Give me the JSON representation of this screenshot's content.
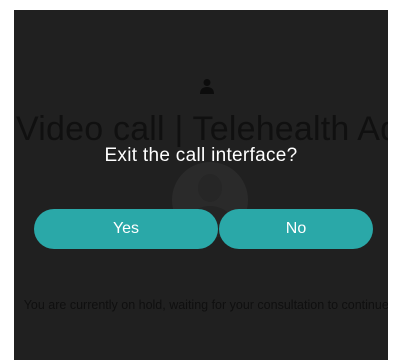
{
  "page": {
    "title": "Video call | Telehealth Admin",
    "status_text": "You are currently on hold, waiting for your consultation to continue."
  },
  "dialog": {
    "title": "Exit the call interface?",
    "yes_label": "Yes",
    "no_label": "No"
  },
  "colors": {
    "overlay": "#202020",
    "button": "#2aa8a8"
  },
  "icons": {
    "user": "user-icon",
    "avatar": "avatar"
  }
}
